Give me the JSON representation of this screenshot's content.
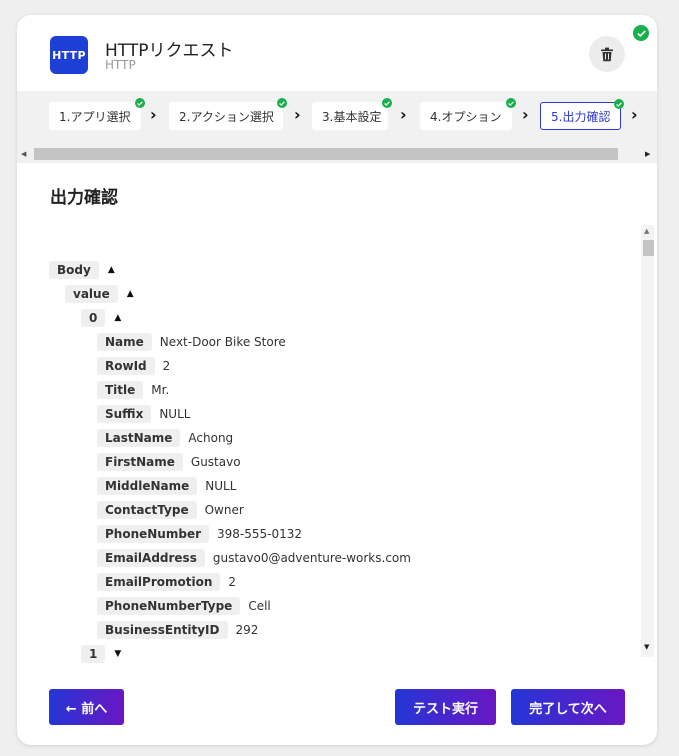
{
  "app": {
    "logo_text": "HTTP",
    "title": "HTTPリクエスト",
    "subtitle": "HTTP",
    "brand_color": "#1d3fd6",
    "complete_color": "#18b04a"
  },
  "steps": [
    {
      "label": "1.アプリ選択",
      "done": true
    },
    {
      "label": "2.アクション選択",
      "done": true
    },
    {
      "label": "3.基本設定",
      "done": true
    },
    {
      "label": "4.オプション",
      "done": true
    },
    {
      "label": "5.出力確認",
      "done": true,
      "active": true
    }
  ],
  "section": {
    "title": "出力確認"
  },
  "tree": {
    "body": {
      "key": "Body"
    },
    "value": {
      "key": "value"
    },
    "item0": {
      "key": "0",
      "fields": [
        {
          "key": "Name",
          "value": "Next-Door Bike Store"
        },
        {
          "key": "RowId",
          "value": "2"
        },
        {
          "key": "Title",
          "value": "Mr."
        },
        {
          "key": "Suffix",
          "value": "NULL"
        },
        {
          "key": "LastName",
          "value": "Achong"
        },
        {
          "key": "FirstName",
          "value": "Gustavo"
        },
        {
          "key": "MiddleName",
          "value": "NULL"
        },
        {
          "key": "ContactType",
          "value": "Owner"
        },
        {
          "key": "PhoneNumber",
          "value": "398-555-0132"
        },
        {
          "key": "EmailAddress",
          "value": "gustavo0@adventure-works.com"
        },
        {
          "key": "EmailPromotion",
          "value": "2"
        },
        {
          "key": "PhoneNumberType",
          "value": "Cell"
        },
        {
          "key": "BusinessEntityID",
          "value": "292"
        }
      ]
    },
    "item1": {
      "key": "1"
    }
  },
  "footer": {
    "back_label": "← 前へ",
    "test_label": "テスト実行",
    "next_label": "完了して次へ"
  },
  "icons": {
    "delete": "trash-icon",
    "check": "check-icon",
    "expand": "triangle-up-icon",
    "collapse": "triangle-down-icon"
  }
}
